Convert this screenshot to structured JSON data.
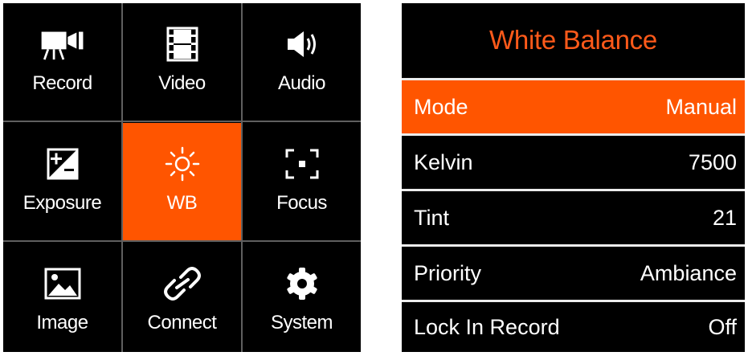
{
  "menu": {
    "items": [
      {
        "label": "Record",
        "icon": "camera-icon"
      },
      {
        "label": "Video",
        "icon": "film-icon"
      },
      {
        "label": "Audio",
        "icon": "speaker-icon"
      },
      {
        "label": "Exposure",
        "icon": "exposure-icon"
      },
      {
        "label": "WB",
        "icon": "sun-icon"
      },
      {
        "label": "Focus",
        "icon": "focus-icon"
      },
      {
        "label": "Image",
        "icon": "image-icon"
      },
      {
        "label": "Connect",
        "icon": "link-icon"
      },
      {
        "label": "System",
        "icon": "gear-icon"
      }
    ],
    "selected": "WB"
  },
  "panel": {
    "title": "White Balance",
    "rows": [
      {
        "label": "Mode",
        "value": "Manual"
      },
      {
        "label": "Kelvin",
        "value": "7500"
      },
      {
        "label": "Tint",
        "value": "21"
      },
      {
        "label": "Priority",
        "value": "Ambiance"
      },
      {
        "label": "Lock In Record",
        "value": "Off"
      }
    ],
    "selected_row": "Mode"
  },
  "colors": {
    "accent": "#ff5500",
    "title": "#ff5a1a",
    "background": "#000000",
    "divider": "#5f5f5f"
  }
}
